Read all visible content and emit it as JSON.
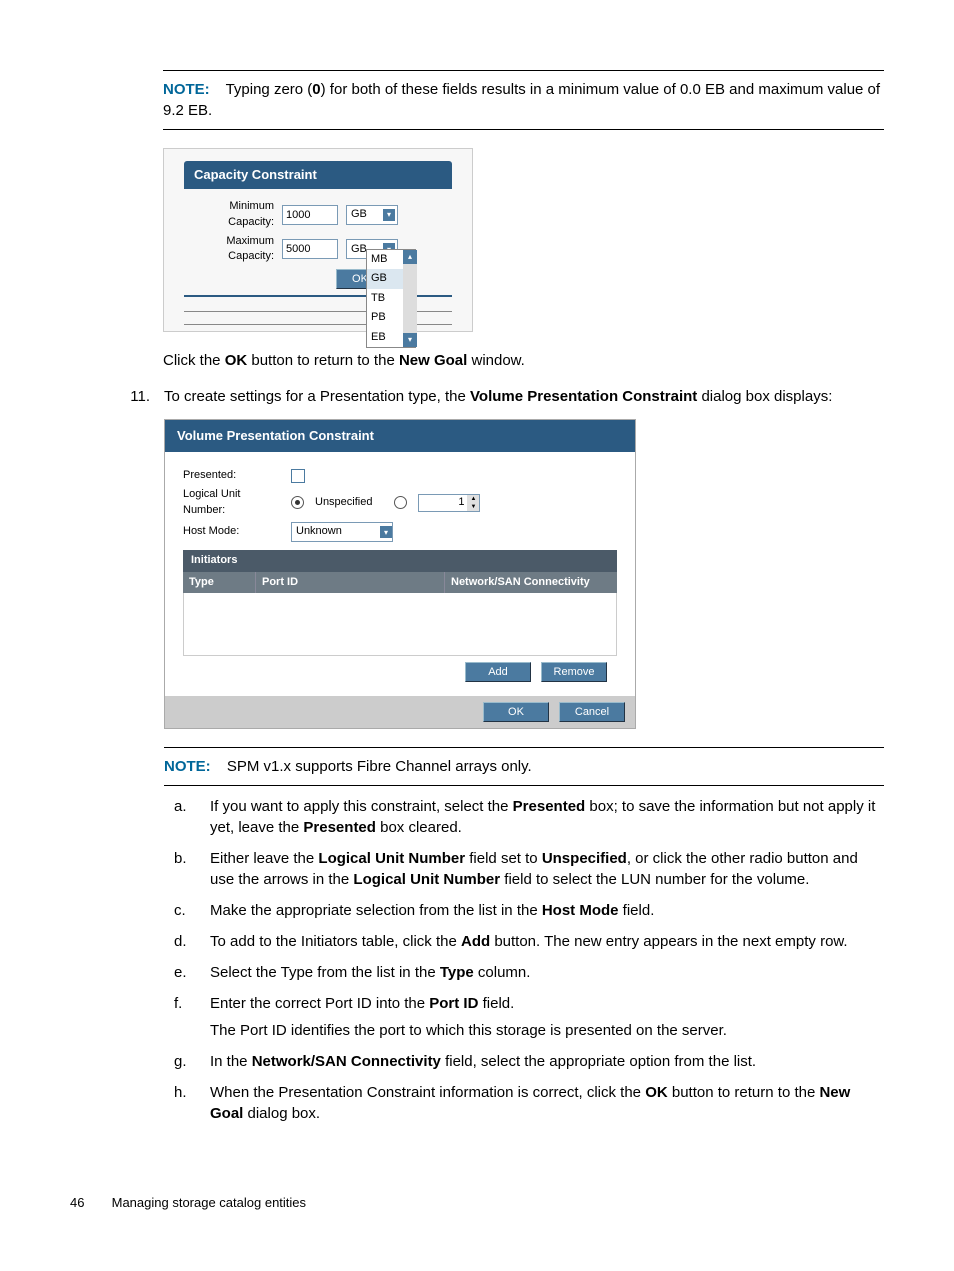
{
  "note1": {
    "label": "NOTE:",
    "text_pre": "Typing zero (",
    "zero": "0",
    "text_post": ") for both of these fields results in a minimum value of 0.0 EB and maximum value of 9.2 EB."
  },
  "fig1": {
    "title": "Capacity Constraint",
    "min_label": "Minimum Capacity:",
    "min_value": "1000",
    "min_unit": "GB",
    "max_label": "Maximum Capacity:",
    "max_value": "5000",
    "max_unit": "GB",
    "ok": "OK",
    "dropdown_options": [
      "MB",
      "GB",
      "TB",
      "PB",
      "EB"
    ],
    "dropdown_selected": "GB"
  },
  "para_click": {
    "pre": "Click the ",
    "ok": "OK",
    "mid": " button to return to the ",
    "ng": "New Goal",
    "post": " window."
  },
  "step11": {
    "num": "11.",
    "pre": "To create settings for a Presentation type, the ",
    "vpc": "Volume Presentation Constraint",
    "post": " dialog box displays:"
  },
  "fig2": {
    "title": "Volume Presentation Constraint",
    "presented_label": "Presented:",
    "lun_label": "Logical Unit Number:",
    "lun_unspec": "Unspecified",
    "lun_value": "1",
    "hostmode_label": "Host Mode:",
    "hostmode_value": "Unknown",
    "initiators": "Initiators",
    "col_type": "Type",
    "col_portid": "Port ID",
    "col_net": "Network/SAN Connectivity",
    "add": "Add",
    "remove": "Remove",
    "ok": "OK",
    "cancel": "Cancel"
  },
  "note2": {
    "label": "NOTE:",
    "text": "SPM v1.x supports Fibre Channel arrays only."
  },
  "substeps": {
    "a": {
      "k": "a.",
      "t1": "If you want to apply this constraint, select the ",
      "b1": "Presented",
      "t2": " box; to save the information but not apply it yet, leave the ",
      "b2": "Presented",
      "t3": " box cleared."
    },
    "b": {
      "k": "b.",
      "t1": "Either leave the ",
      "b1": "Logical Unit Number",
      "t2": " field set to ",
      "b2": "Unspecified",
      "t3": ", or click the other radio button and use the arrows in the ",
      "b3": "Logical Unit Number",
      "t4": " field to select the LUN number for the volume."
    },
    "c": {
      "k": "c.",
      "t1": "Make the appropriate selection from the list in the ",
      "b1": "Host Mode",
      "t2": " field."
    },
    "d": {
      "k": "d.",
      "t1": "To add to the Initiators table, click the ",
      "b1": "Add",
      "t2": " button. The new entry appears in the next empty row."
    },
    "e": {
      "k": "e.",
      "t1": "Select the Type from the list in the ",
      "b1": "Type",
      "t2": " column."
    },
    "f": {
      "k": "f.",
      "t1": "Enter the correct Port ID into the ",
      "b1": "Port ID",
      "t2": " field.",
      "extra": "The Port ID identifies the port to which this storage is presented on the server."
    },
    "g": {
      "k": "g.",
      "t1": "In the ",
      "b1": "Network/SAN Connectivity",
      "t2": " field, select the appropriate option from the list."
    },
    "h": {
      "k": "h.",
      "t1": "When the Presentation Constraint information is correct, click the ",
      "b1": "OK",
      "t2": " button to return to the ",
      "b2": "New Goal",
      "t3": " dialog box."
    }
  },
  "footer": {
    "page": "46",
    "title": "Managing storage catalog entities"
  }
}
